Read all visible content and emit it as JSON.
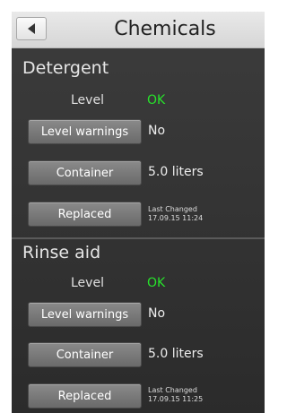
{
  "header": {
    "title": "Chemicals"
  },
  "detergent": {
    "title": "Detergent",
    "level_label": "Level",
    "level_value": "OK",
    "level_warnings_button": "Level warnings",
    "level_warnings_value": "No",
    "container_button": "Container",
    "container_value": "5.0 liters",
    "replaced_button": "Replaced",
    "last_changed_label": "Last Changed",
    "last_changed_value": "17.09.15 11:24"
  },
  "rinse_aid": {
    "title": "Rinse aid",
    "level_label": "Level",
    "level_value": "OK",
    "level_warnings_button": "Level warnings",
    "level_warnings_value": "No",
    "container_button": "Container",
    "container_value": "5.0 liters",
    "replaced_button": "Replaced",
    "last_changed_label": "Last Changed",
    "last_changed_value": "17.09.15 11:25"
  },
  "colors": {
    "ok": "#27e22b",
    "background": "#333333"
  }
}
